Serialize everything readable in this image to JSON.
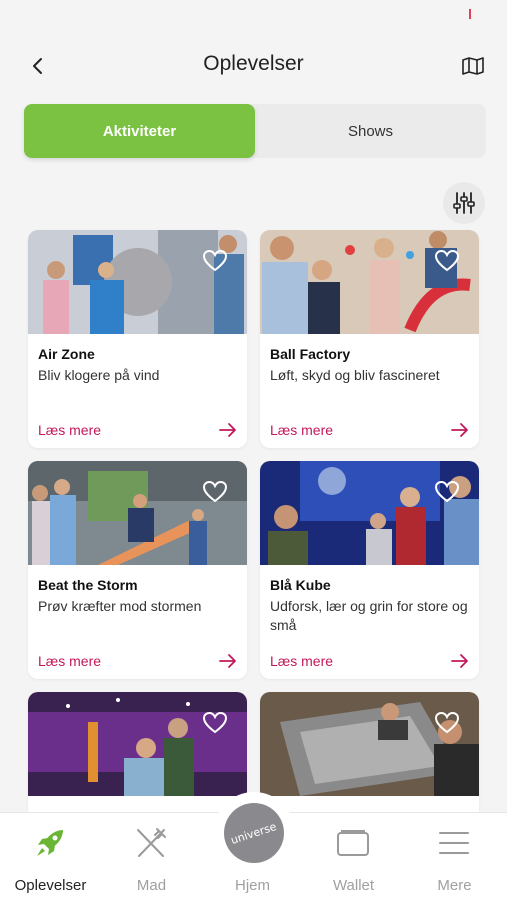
{
  "header": {
    "title": "Oplevelser",
    "back_icon": "chevron-left-icon",
    "map_icon": "map-icon"
  },
  "segments": {
    "active": "Aktiviteter",
    "inactive": "Shows",
    "active_color": "#7cc242"
  },
  "filter_icon": "sliders-icon",
  "cards": [
    {
      "title": "Air Zone",
      "subtitle": "Bliv klogere på vind",
      "link": "Læs mere"
    },
    {
      "title": "Ball Factory",
      "subtitle": "Løft, skyd og bliv fascineret",
      "link": "Læs mere"
    },
    {
      "title": "Beat the Storm",
      "subtitle": "Prøv kræfter mod stormen",
      "link": "Læs mere"
    },
    {
      "title": "Blå Kube",
      "subtitle": "Udforsk, lær og grin for store og små",
      "link": "Læs mere"
    },
    {
      "title": "",
      "subtitle": "",
      "link": ""
    },
    {
      "title": "",
      "subtitle": "",
      "link": ""
    }
  ],
  "tabbar": {
    "items": [
      {
        "label": "Oplevelser",
        "icon": "rocket-icon"
      },
      {
        "label": "Mad",
        "icon": "fork-knife-icon"
      },
      {
        "label": "Hjem",
        "icon": "universe-logo-icon"
      },
      {
        "label": "Wallet",
        "icon": "wallet-icon"
      },
      {
        "label": "Mere",
        "icon": "menu-icon"
      }
    ],
    "home_logo_text": "universe"
  },
  "link_color": "#c2185b"
}
